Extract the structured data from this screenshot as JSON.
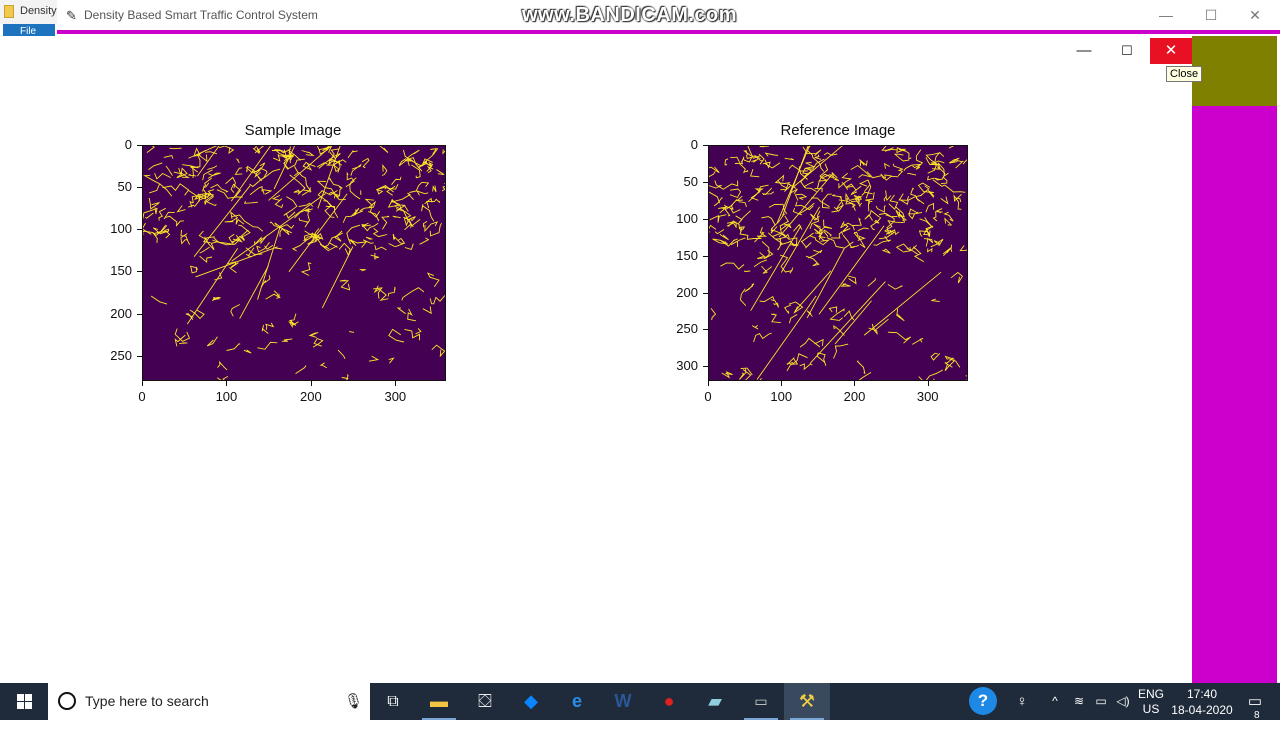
{
  "background_app": {
    "title": "Density",
    "menu_file": "File"
  },
  "main_window": {
    "title": "Density Based Smart Traffic Control System",
    "icon": "feather-icon"
  },
  "watermark": "www.BANDICAM.com",
  "figure_window": {
    "tooltip": "Close"
  },
  "plots": {
    "left": {
      "title": "Sample Image",
      "xticks": [
        "0",
        "100",
        "200",
        "300"
      ],
      "yticks": [
        "0",
        "50",
        "100",
        "150",
        "200",
        "250"
      ]
    },
    "right": {
      "title": "Reference Image",
      "xticks": [
        "0",
        "100",
        "200",
        "300"
      ],
      "yticks": [
        "0",
        "50",
        "100",
        "150",
        "200",
        "250",
        "300"
      ]
    }
  },
  "chart_data": [
    {
      "type": "heatmap",
      "title": "Sample Image",
      "xlim": [
        0,
        360
      ],
      "ylim": [
        0,
        280
      ],
      "xticks": [
        0,
        100,
        200,
        300
      ],
      "yticks": [
        0,
        50,
        100,
        150,
        200,
        250
      ],
      "colormap": "viridis",
      "background_color": "#440154",
      "edge_color": "#fde725"
    },
    {
      "type": "heatmap",
      "title": "Reference Image",
      "xlim": [
        0,
        355
      ],
      "ylim": [
        0,
        320
      ],
      "xticks": [
        0,
        100,
        200,
        300
      ],
      "yticks": [
        0,
        50,
        100,
        150,
        200,
        250,
        300
      ],
      "colormap": "viridis",
      "background_color": "#440154",
      "edge_color": "#fde725"
    }
  ],
  "taskbar": {
    "search_placeholder": "Type here to search",
    "apps": [
      "task-view",
      "file-explorer",
      "store",
      "dropbox",
      "edge",
      "word",
      "record",
      "notepad",
      "terminal",
      "python-idle"
    ],
    "lang_line1": "ENG",
    "lang_line2": "US",
    "time": "17:40",
    "date": "18-04-2020",
    "notification_count": "8"
  }
}
